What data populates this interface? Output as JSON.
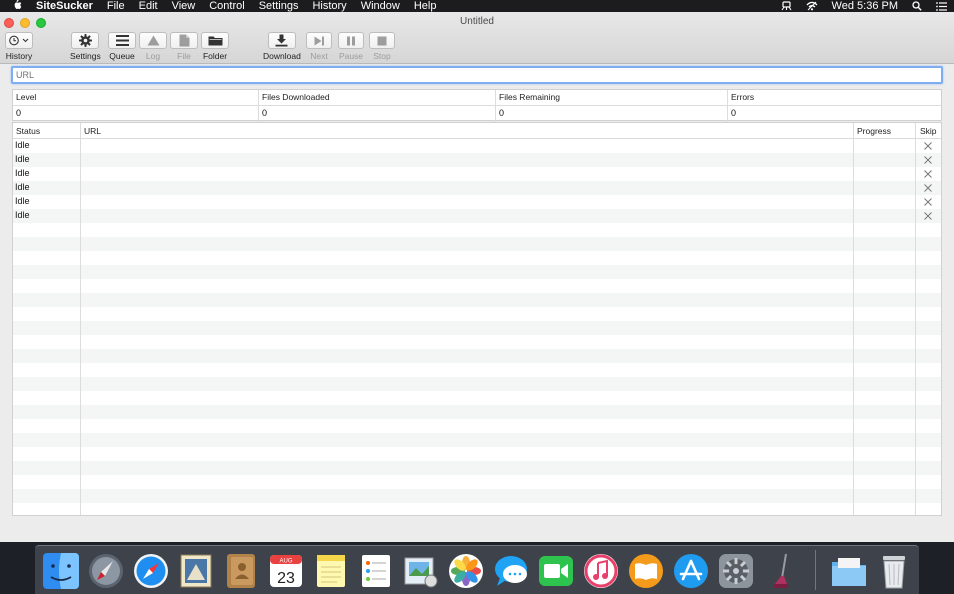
{
  "menubar": {
    "app_name": "SiteSucker",
    "items": [
      "File",
      "Edit",
      "View",
      "Control",
      "Settings",
      "History",
      "Window",
      "Help"
    ],
    "clock": "Wed 5:36 PM",
    "apple_glyph": ""
  },
  "window": {
    "title": "Untitled"
  },
  "toolbar": {
    "history_label": "History",
    "settings_label": "Settings",
    "queue_label": "Queue",
    "log_label": "Log",
    "file_label": "File",
    "folder_label": "Folder",
    "download_label": "Download",
    "next_label": "Next",
    "pause_label": "Pause",
    "stop_label": "Stop"
  },
  "url_field": {
    "placeholder": "URL",
    "value": ""
  },
  "stats": {
    "level_header": "Level",
    "level_value": "0",
    "files_downloaded_header": "Files Downloaded",
    "files_downloaded_value": "0",
    "files_remaining_header": "Files Remaining",
    "files_remaining_value": "0",
    "errors_header": "Errors",
    "errors_value": "0"
  },
  "table": {
    "columns": [
      "Status",
      "URL",
      "Progress",
      "Skip"
    ],
    "rows": [
      {
        "status": "Idle",
        "url": "",
        "progress": ""
      },
      {
        "status": "Idle",
        "url": "",
        "progress": ""
      },
      {
        "status": "Idle",
        "url": "",
        "progress": ""
      },
      {
        "status": "Idle",
        "url": "",
        "progress": ""
      },
      {
        "status": "Idle",
        "url": "",
        "progress": ""
      },
      {
        "status": "Idle",
        "url": "",
        "progress": ""
      }
    ]
  },
  "dock": {
    "icons": [
      "finder-icon",
      "launchpad-icon",
      "safari-icon",
      "mail-icon",
      "contacts-icon",
      "calendar-icon",
      "notes-icon",
      "reminders-icon",
      "preview-icon",
      "photos-icon",
      "messages-icon",
      "facetime-icon",
      "itunes-icon",
      "ibooks-icon",
      "app-store-icon",
      "system-preferences-icon",
      "sitesucker-icon",
      "downloads-folder-icon",
      "trash-icon"
    ],
    "calendar_month": "AUG",
    "calendar_day": "23"
  },
  "colors": {
    "accent": "#7eaef1",
    "close": "#fc5f57",
    "minimize": "#fdbc2e",
    "maximize": "#28c840"
  }
}
